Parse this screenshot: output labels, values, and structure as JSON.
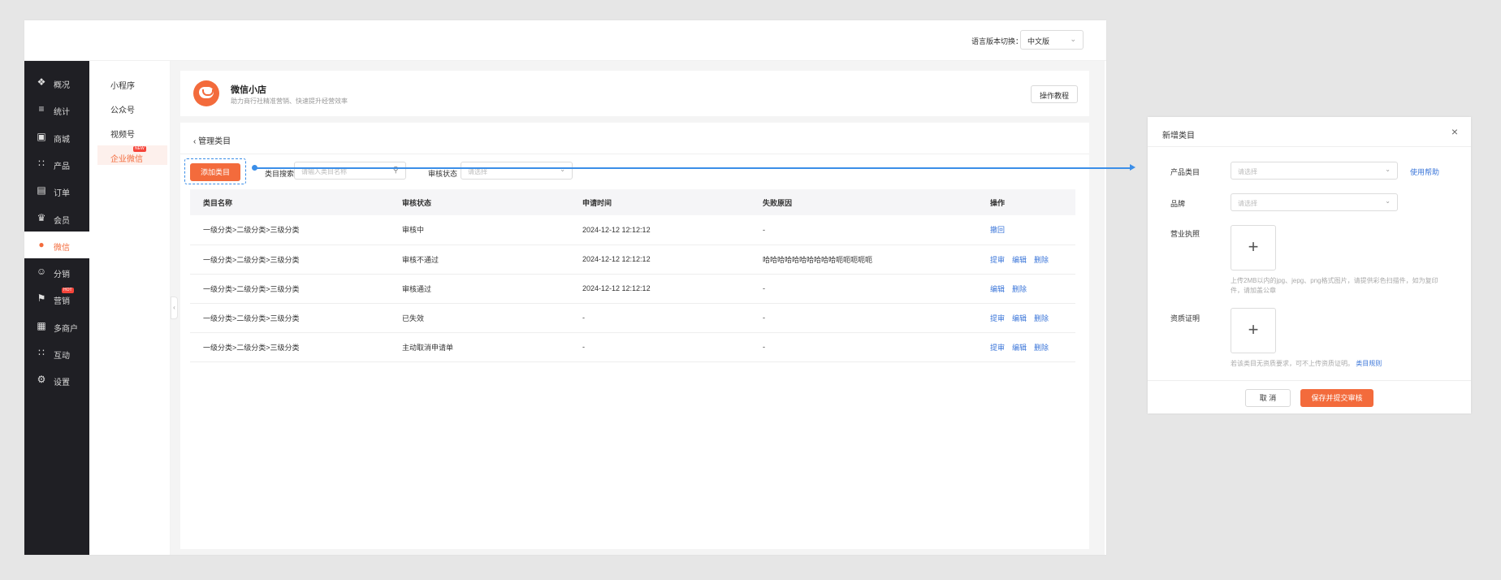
{
  "topbar": {
    "lang_label": "语言版本切换：",
    "lang_value": "中文版"
  },
  "sidebar": {
    "items": [
      {
        "icon": "graduation-icon",
        "glyph": "❖",
        "label": "概况"
      },
      {
        "icon": "chart-icon",
        "glyph": "≡",
        "label": "统计"
      },
      {
        "icon": "store-icon",
        "glyph": "▣",
        "label": "商城"
      },
      {
        "icon": "grid-icon",
        "glyph": "∷",
        "label": "产品"
      },
      {
        "icon": "order-icon",
        "glyph": "▤",
        "label": "订单"
      },
      {
        "icon": "crown-icon",
        "glyph": "♛",
        "label": "会员"
      },
      {
        "icon": "wechat-icon",
        "glyph": "●",
        "label": "微信"
      },
      {
        "icon": "distribution-icon",
        "glyph": "☺",
        "label": "分销"
      },
      {
        "icon": "flag-icon",
        "glyph": "⚑",
        "label": "营销"
      },
      {
        "icon": "merchant-icon",
        "glyph": "▦",
        "label": "多商户"
      },
      {
        "icon": "interact-icon",
        "glyph": "∷",
        "label": "互动"
      },
      {
        "icon": "gear-icon",
        "glyph": "⚙",
        "label": "设置"
      }
    ],
    "hot_badge": "HOT"
  },
  "subnav": {
    "items": [
      "小程序",
      "公众号",
      "视频号",
      "企业微信"
    ],
    "new_badge": "NEW"
  },
  "header": {
    "title": "微信小店",
    "subtitle": "助力商行社精准营销、快速提升经营效率",
    "help_button": "操作教程"
  },
  "main": {
    "back_label": "管理类目",
    "add_button": "添加类目",
    "search_label": "类目搜索",
    "search_placeholder": "请输入类目名称",
    "status_label": "审核状态",
    "status_placeholder": "请选择",
    "columns": [
      "类目名称",
      "审核状态",
      "申请时间",
      "失败原因",
      "操作"
    ],
    "rows": [
      {
        "name": "一级分类>二级分类>三级分类",
        "status": "审核中",
        "time": "2024-12-12 12:12:12",
        "reason": "-",
        "ops": [
          "撤回"
        ]
      },
      {
        "name": "一级分类>二级分类>三级分类",
        "status": "审核不通过",
        "time": "2024-12-12 12:12:12",
        "reason": "哈哈哈哈哈哈哈哈哈哈呃呃呃呃呃",
        "ops": [
          "提审",
          "编辑",
          "删除"
        ]
      },
      {
        "name": "一级分类>二级分类>三级分类",
        "status": "审核通过",
        "time": "2024-12-12 12:12:12",
        "reason": "-",
        "ops": [
          "编辑",
          "删除"
        ]
      },
      {
        "name": "一级分类>二级分类>三级分类",
        "status": "已失效",
        "time": "-",
        "reason": "-",
        "ops": [
          "提审",
          "编辑",
          "删除"
        ]
      },
      {
        "name": "一级分类>二级分类>三级分类",
        "status": "主动取消申请单",
        "time": "-",
        "reason": "-",
        "ops": [
          "提审",
          "编辑",
          "删除"
        ]
      }
    ]
  },
  "dialog": {
    "title": "新增类目",
    "product_category_label": "产品类目",
    "product_category_placeholder": "请选择",
    "help_link": "使用帮助",
    "brand_label": "品牌",
    "brand_placeholder": "请选择",
    "license_label": "营业执照",
    "license_hint": "上传2MB以内的jpg、jepg、png格式图片，请提供彩色扫描件，如为复印件，请加盖公章",
    "qualification_label": "资质证明",
    "qualification_hint": "若该类目无资质要求，可不上传资质证明。",
    "qualification_link": "类目规则",
    "cancel_button": "取 消",
    "save_button": "保存并提交审核"
  }
}
